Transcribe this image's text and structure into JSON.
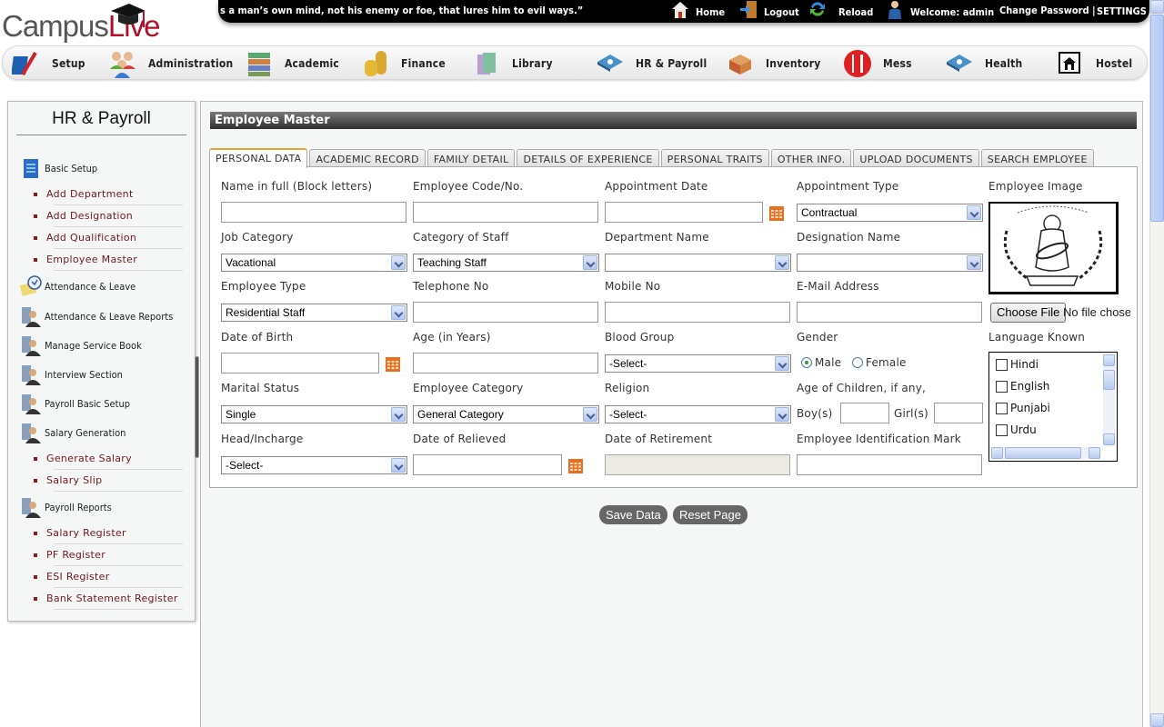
{
  "brand": {
    "name_part1": "Campus",
    "name_part2": "Live"
  },
  "topbar": {
    "ticker": "s a man’s own mind, not his enemy or foe, that lures him to evil ways.”",
    "home": "Home",
    "logout": "Logout",
    "reload": "Reload",
    "welcome": "Welcome: admin",
    "change_password": "Change Password |",
    "settings": "SETTINGS"
  },
  "nav": [
    {
      "label": "Setup",
      "icon": "setup-icon"
    },
    {
      "label": "Administration",
      "icon": "administration-icon"
    },
    {
      "label": "Academic",
      "icon": "books-icon"
    },
    {
      "label": "Finance",
      "icon": "coins-icon"
    },
    {
      "label": "Library",
      "icon": "library-icon"
    },
    {
      "label": "HR & Payroll",
      "icon": "hr-payroll-icon"
    },
    {
      "label": "Inventory",
      "icon": "inventory-icon"
    },
    {
      "label": "Mess",
      "icon": "fork-knife-icon"
    },
    {
      "label": "Health",
      "icon": "health-icon"
    },
    {
      "label": "Hostel",
      "icon": "hostel-icon"
    }
  ],
  "sidebar": {
    "title": "HR & Payroll",
    "sections": [
      {
        "label": "Basic Setup",
        "icon": "document-icon",
        "items": [
          "Add Department",
          "Add Designation",
          "Add Qualification",
          "Employee Master"
        ]
      },
      {
        "label": "Attendance & Leave",
        "icon": "clock-notes-icon",
        "items": []
      },
      {
        "label": "Attendance & Leave Reports",
        "icon": "manager-icon",
        "items": []
      },
      {
        "label": "Manage Service Book",
        "icon": "manager-icon",
        "items": []
      },
      {
        "label": "Interview Section",
        "icon": "manager-icon",
        "items": []
      },
      {
        "label": "Payroll Basic Setup",
        "icon": "manager-icon",
        "items": []
      },
      {
        "label": "Salary Generation",
        "icon": "manager-icon",
        "items": [
          "Generate Salary",
          "Salary Slip"
        ]
      },
      {
        "label": "Payroll Reports",
        "icon": "manager-icon",
        "items": [
          "Salary Register",
          "PF Register",
          "ESI Register",
          "Bank Statement Register"
        ]
      }
    ]
  },
  "main": {
    "title": "Employee Master",
    "tabs": [
      "PERSONAL DATA",
      "ACADEMIC RECORD",
      "FAMILY DETAIL",
      "DETAILS OF EXPERIENCE",
      "PERSONAL TRAITS",
      "OTHER INFO.",
      "UPLOAD DOCUMENTS",
      "SEARCH EMPLOYEE"
    ],
    "active_tab": "PERSONAL DATA",
    "fields": {
      "name_full": {
        "label": "Name in full (Block letters)",
        "value": ""
      },
      "employee_code": {
        "label": "Employee Code/No.",
        "value": ""
      },
      "appointment_date": {
        "label": "Appointment Date",
        "value": ""
      },
      "appointment_type": {
        "label": "Appointment Type",
        "value": "Contractual"
      },
      "employee_image": {
        "label": "Employee Image"
      },
      "job_category": {
        "label": "Job Category",
        "value": "Vacational"
      },
      "category_of_staff": {
        "label": "Category of Staff",
        "value": "Teaching Staff"
      },
      "department_name": {
        "label": "Department Name",
        "value": ""
      },
      "designation_name": {
        "label": "Designation Name",
        "value": ""
      },
      "employee_type": {
        "label": "Employee Type",
        "value": "Residential Staff"
      },
      "telephone": {
        "label": "Telephone No",
        "value": ""
      },
      "mobile": {
        "label": "Mobile No",
        "value": ""
      },
      "email": {
        "label": "E-Mail Address",
        "value": ""
      },
      "file_upload": {
        "button": "Choose File",
        "status": "No file chosen"
      },
      "dob": {
        "label": "Date of Birth",
        "value": ""
      },
      "age": {
        "label": "Age (in Years)",
        "value": ""
      },
      "blood_group": {
        "label": "Blood Group",
        "value": "-Select-"
      },
      "gender": {
        "label": "Gender",
        "options": [
          "Male",
          "Female"
        ],
        "selected": "Male"
      },
      "language_known": {
        "label": "Language Known",
        "options": [
          "Hindi",
          "English",
          "Punjabi",
          "Urdu"
        ]
      },
      "marital_status": {
        "label": "Marital Status",
        "value": "Single"
      },
      "employee_category": {
        "label": "Employee Category",
        "value": "General Category"
      },
      "religion": {
        "label": "Religion",
        "value": "-Select-"
      },
      "children": {
        "label": "Age of Children, if any,",
        "boys_label": "Boy(s)",
        "girls_label": "Girl(s)",
        "boys": "",
        "girls": ""
      },
      "head_incharge": {
        "label": "Head/Incharge",
        "value": "-Select-"
      },
      "date_relieved": {
        "label": "Date of Relieved",
        "value": ""
      },
      "date_retirement": {
        "label": "Date of Retirement",
        "value": ""
      },
      "identification_mark": {
        "label": "Employee Identification Mark",
        "value": ""
      }
    },
    "buttons": {
      "save": "Save Data",
      "reset": "Reset Page"
    }
  },
  "colors": {
    "accent_tab": "#f0a030",
    "link": "#6d1a20",
    "title_bar": "#3a3a3a",
    "button": "#666666"
  }
}
